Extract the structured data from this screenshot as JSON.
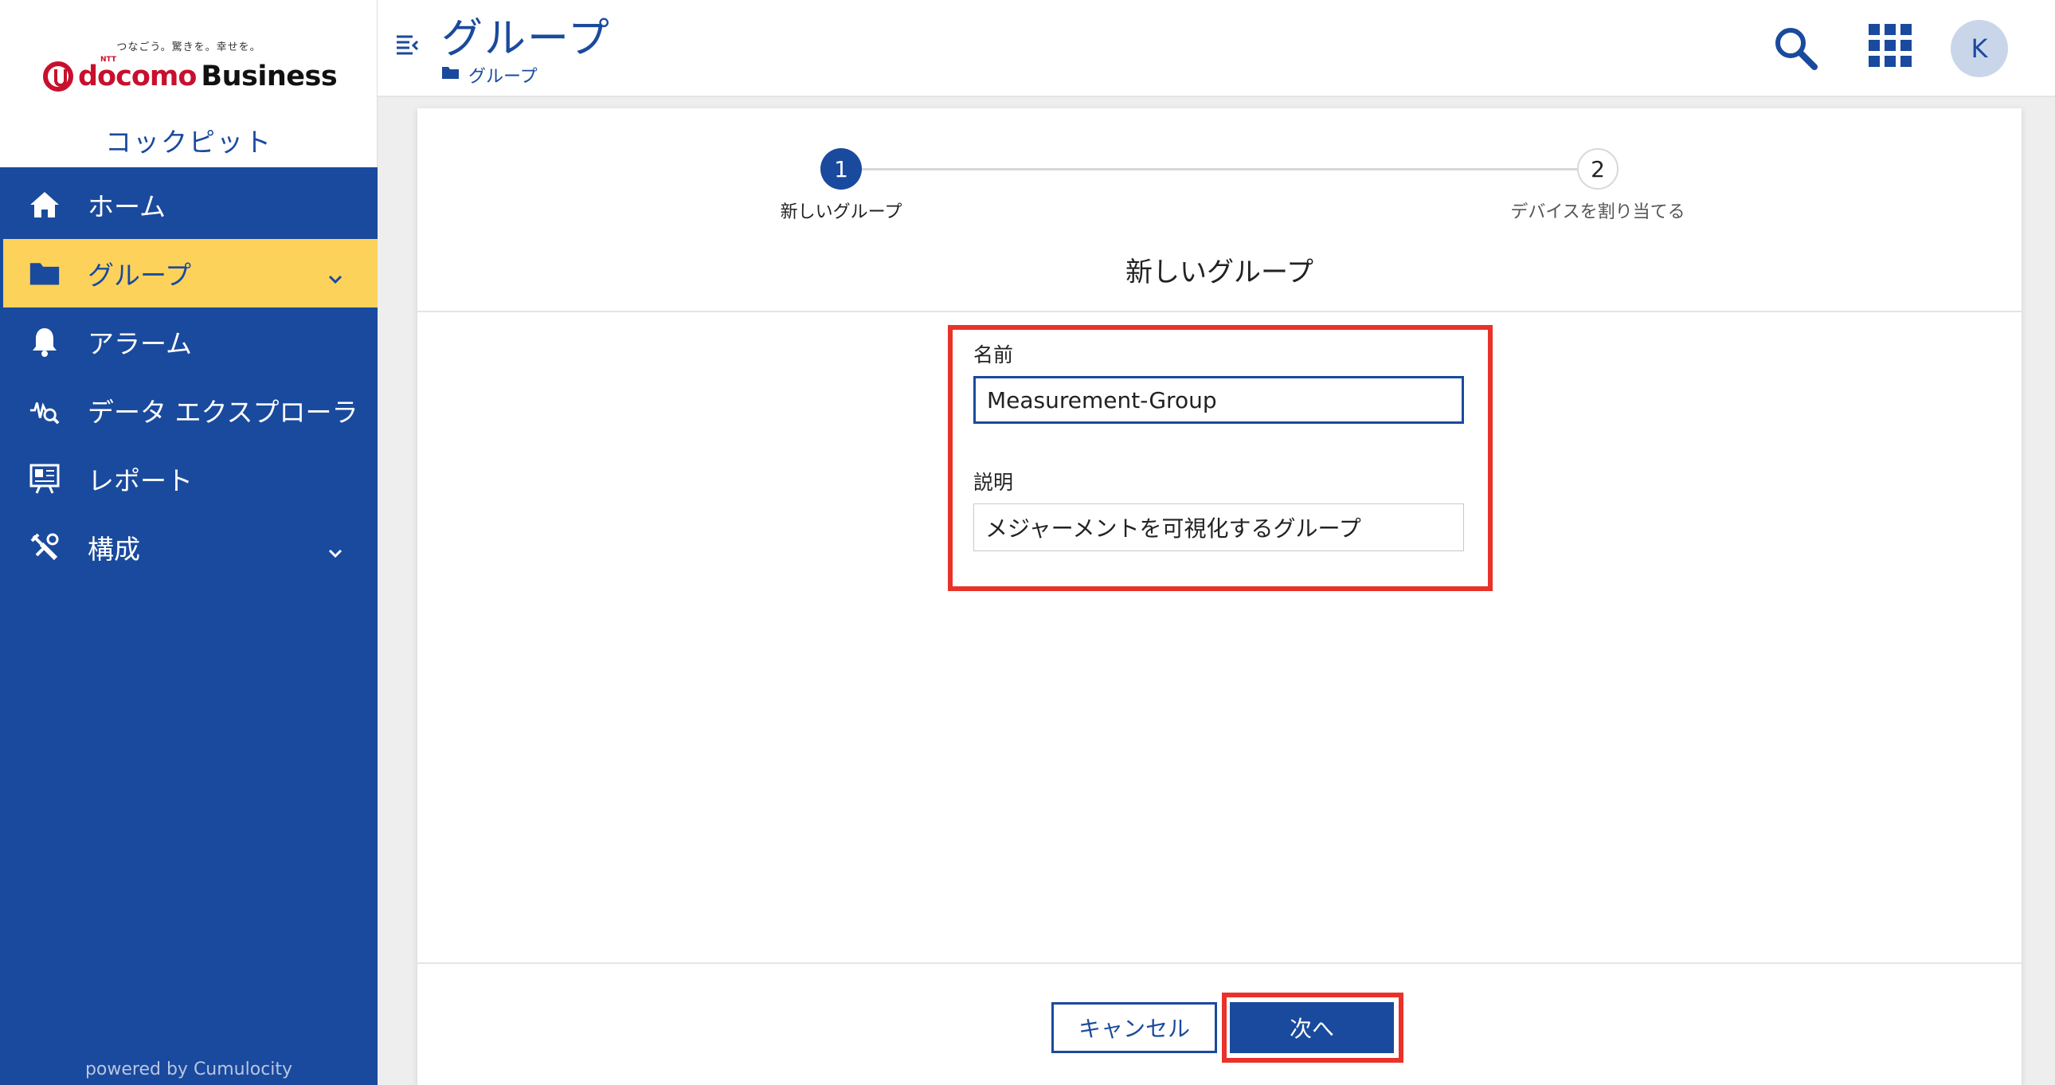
{
  "brand": {
    "tagline": "つなごう。驚きを。幸せを。",
    "logo_mark": "NTT",
    "logo_docomo": "docomo",
    "logo_business": "Business",
    "app_name": "コックピット"
  },
  "sidebar": {
    "items": [
      {
        "label": "ホーム",
        "icon": "home-icon"
      },
      {
        "label": "グループ",
        "icon": "folder-icon",
        "active": true
      },
      {
        "label": "アラーム",
        "icon": "bell-icon"
      },
      {
        "label": "データ エクスプローラ",
        "icon": "data-explorer-icon"
      },
      {
        "label": "レポート",
        "icon": "report-icon"
      },
      {
        "label": "構成",
        "icon": "wrench-icon"
      }
    ],
    "powered_by": "powered by Cumulocity"
  },
  "header": {
    "title": "グループ",
    "breadcrumb": "グループ",
    "avatar_initial": "K"
  },
  "stepper": {
    "steps": [
      {
        "number": "1",
        "label": "新しいグループ"
      },
      {
        "number": "2",
        "label": "デバイスを割り当てる"
      }
    ]
  },
  "form": {
    "title": "新しいグループ",
    "name_label": "名前",
    "name_value": "Measurement-Group",
    "description_label": "説明",
    "description_value": "メジャーメントを可視化するグループ"
  },
  "buttons": {
    "cancel": "キャンセル",
    "next": "次へ"
  },
  "colors": {
    "primary": "#1a4a9d",
    "active_nav": "#fdd25b",
    "highlight": "#e8322a",
    "brand_red": "#c8102e"
  }
}
